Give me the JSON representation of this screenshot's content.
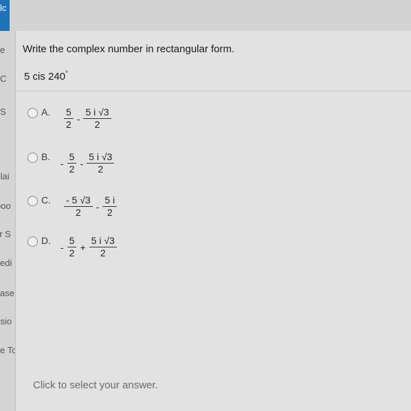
{
  "window": {
    "tab_fragment": "lc"
  },
  "sidebar": {
    "items": [
      "e",
      "C",
      "S",
      "Plai",
      "boo",
      "or S",
      "edi",
      "ase",
      "ssio",
      "e To"
    ]
  },
  "question": {
    "prompt": "Write the complex number in rectangular form.",
    "expression": "5 cis 240",
    "degree_symbol": "°"
  },
  "options": [
    {
      "letter": "A.",
      "terms": [
        {
          "sign": "",
          "num": "5",
          "den": "2"
        },
        {
          "sign": "-",
          "num": "5 i √3",
          "den": "2"
        }
      ]
    },
    {
      "letter": "B.",
      "terms": [
        {
          "sign": "-",
          "num": "5",
          "den": "2"
        },
        {
          "sign": "-",
          "num": "5 i √3",
          "den": "2"
        }
      ]
    },
    {
      "letter": "C.",
      "terms": [
        {
          "sign": "",
          "num": "- 5 √3",
          "den": "2"
        },
        {
          "sign": "-",
          "num": "5 i",
          "den": "2"
        }
      ]
    },
    {
      "letter": "D.",
      "terms": [
        {
          "sign": "-",
          "num": "5",
          "den": "2"
        },
        {
          "sign": "+",
          "num": "5 i √3",
          "den": "2"
        }
      ]
    }
  ],
  "footer": {
    "hint": "Click to select your answer."
  },
  "colors": {
    "accent_tab": "#1f72b8",
    "background": "#e2e2e2"
  }
}
